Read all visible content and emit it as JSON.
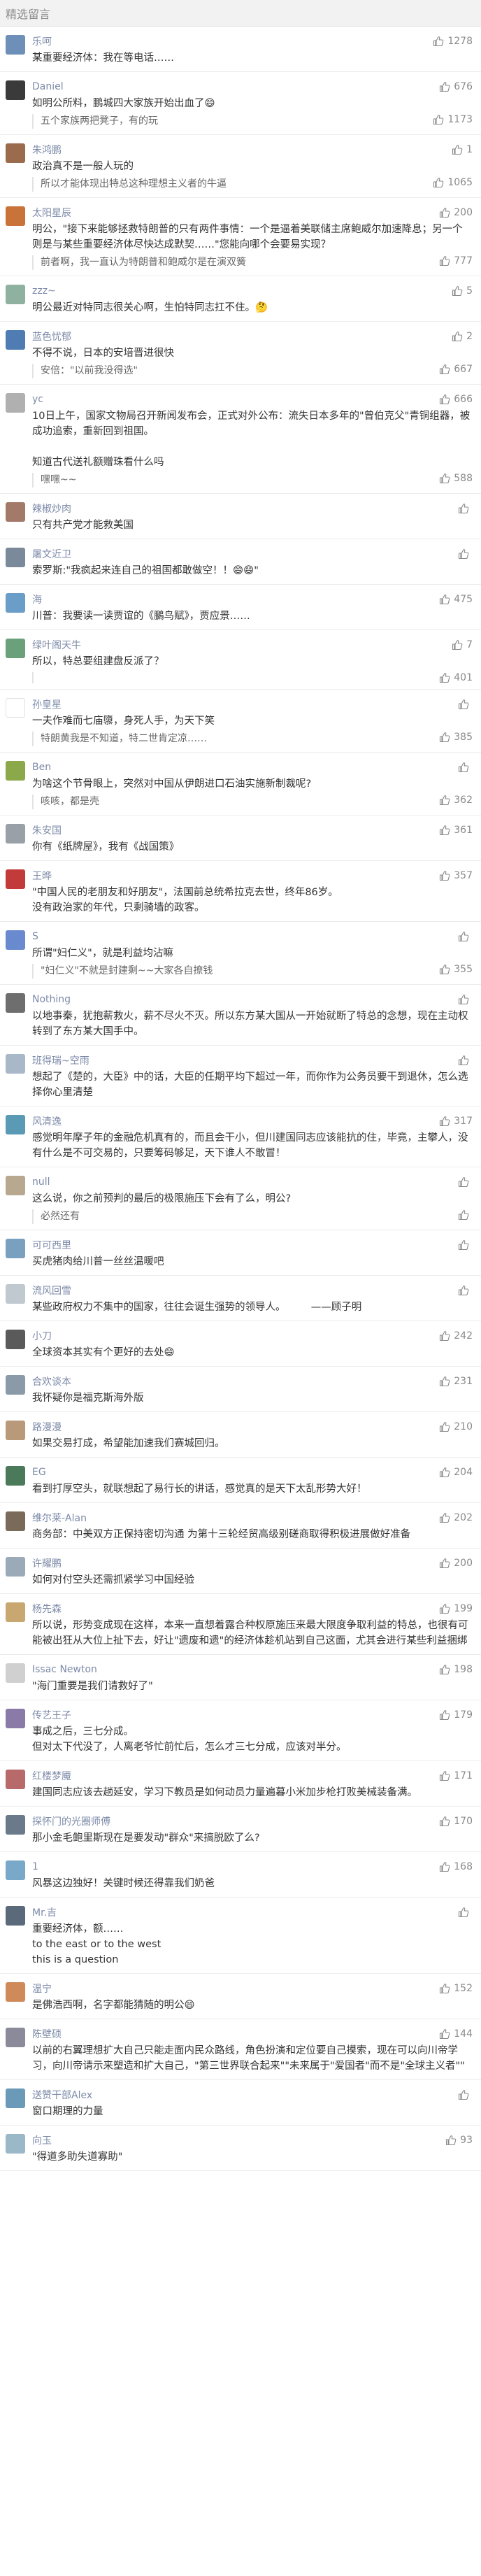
{
  "section": {
    "title": "精选留言"
  },
  "colors": {
    "nickname": "#7c8aa8",
    "text": "#333333",
    "reply_text": "#666666",
    "muted": "#8a8a8a",
    "reply_border": "#e3e3e3"
  },
  "comments": [
    {
      "nickname": "乐呵",
      "avatar_color": "#6d8fb8",
      "likes": "1278",
      "content": "某重要经济体：我在等电话……",
      "reply": null
    },
    {
      "nickname": "Daniel",
      "avatar_color": "#3a3a3a",
      "likes": "676",
      "content": "如明公所料，鹏城四大家族开始出血了😄",
      "reply": {
        "content": "五个家族两把凳子，有的玩",
        "likes": "1173"
      }
    },
    {
      "nickname": "朱鸿鹏",
      "avatar_color": "#9a6b4d",
      "likes": "1",
      "content": "政治真不是一般人玩的",
      "reply": {
        "content": "所以才能体现出特总这种理想主义者的牛逼",
        "likes": "1065"
      }
    },
    {
      "nickname": "太阳星辰",
      "avatar_color": "#c9733a",
      "likes": "200",
      "content": "明公，\"接下来能够拯救特朗普的只有两件事情：一个是逼着美联储主席鲍威尔加速降息；另一个则是与某些重要经济体尽快达成默契……\"您能向哪个会要易实现？",
      "reply": {
        "content": "前者啊，我一直认为特朗普和鲍威尔是在演双簧",
        "likes": "777"
      }
    },
    {
      "nickname": "zzz~",
      "avatar_color": "#8fb2a0",
      "likes": "5",
      "content": "明公最近对特同志很关心啊，生怕特同志扛不住。🤔",
      "reply": null
    },
    {
      "nickname": "蓝色忧郁",
      "avatar_color": "#4f7db3",
      "likes": "2",
      "content": "不得不说，日本的安培晋进很快",
      "reply": {
        "content": "安倍：\"以前我没得选\"",
        "likes": "667"
      }
    },
    {
      "nickname": "yc",
      "avatar_color": "#b0b0b0",
      "likes": "666",
      "content": "10日上午，国家文物局召开新闻发布会，正式对外公布：流失日本多年的\"曾伯克父\"青铜组器，被成功追索，重新回到祖国。\n\n知道古代送礼额赠珠看什么吗",
      "reply": {
        "content": "嘿嘿~~",
        "likes": "588"
      }
    },
    {
      "nickname": "辣椒炒肉",
      "avatar_color": "#a37a6a",
      "likes": "",
      "content": "只有共产党才能救美国",
      "reply": null
    },
    {
      "nickname": "屠文近卫",
      "avatar_color": "#7a8a9a",
      "likes": "",
      "content": "索罗斯:\"我疯起来连自己的祖国都敢做空！！😄😄\"",
      "reply": null
    },
    {
      "nickname": "海",
      "avatar_color": "#6a9ec8",
      "likes": "475",
      "content": "川普：我要读一读贾谊的《鵩鸟赋》，贾应景……",
      "reply": null
    },
    {
      "nickname": "绿叶阁天牛",
      "avatar_color": "#6aa07a",
      "likes": "7",
      "content": "所以，特总要组建盘反派了？",
      "reply": {
        "content": "",
        "likes": "401"
      }
    },
    {
      "nickname": "孙皇星",
      "avatar_color": "#ffffff",
      "likes": "",
      "content": "一夫作难而七庙隳，身死人手，为天下笑",
      "reply": {
        "content": "特朗黄我是不知道，特二世肯定凉……",
        "likes": "385"
      }
    },
    {
      "nickname": "Ben",
      "avatar_color": "#8ba84a",
      "likes": "",
      "content": "为啥这个节骨眼上，突然对中国从伊朗进口石油实施新制裁呢?",
      "reply": {
        "content": "咳咳，都是壳",
        "likes": "362"
      }
    },
    {
      "nickname": "朱安国",
      "avatar_color": "#9aa0a8",
      "likes": "361",
      "content": "你有《纸牌屋》，我有《战国策》",
      "reply": null
    },
    {
      "nickname": "王晔",
      "avatar_color": "#c23a3a",
      "likes": "357",
      "content": "\"中国人民的老朋友和好朋友\"，法国前总统希拉克去世，终年86岁。\n没有政治家的年代，只剩骑墙的政客。",
      "reply": null
    },
    {
      "nickname": "S",
      "avatar_color": "#6a8ad0",
      "likes": "",
      "content": "所谓\"妇仁义\"，就是利益均沾嘛",
      "reply": {
        "content": "\"妇仁义\"不就是封建剩~~大家各自撩钱",
        "likes": "355"
      }
    },
    {
      "nickname": "Nothing",
      "avatar_color": "#6e6e6e",
      "likes": "",
      "content": "以地事秦，犹抱薪救火，薪不尽火不灭。所以东方某大国从一开始就断了特总的念想，现在主动权转到了东方某大国手中。",
      "reply": null
    },
    {
      "nickname": "班得瑞~空雨",
      "avatar_color": "#a8b8c8",
      "likes": "",
      "content": "想起了《楚的，大臣》中的话，大臣的任期平均下超过一年，而你作为公务员要干到退休，怎么选择你心里清楚",
      "reply": null
    },
    {
      "nickname": "风清逸",
      "avatar_color": "#5a9ab5",
      "likes": "317",
      "content": "感觉明年摩子年的金融危机真有的，而且会干小，但川建国同志应该能抗的住，毕竟，主攀人，没有什么是不可交易的，只要筹码够足，天下谁人不敢冒！",
      "reply": null
    },
    {
      "nickname": "null",
      "avatar_color": "#b8a890",
      "likes": "",
      "content": "这么说，你之前预判的最后的极限施压下会有了么，明公?",
      "reply": {
        "content": "必然还有",
        "likes": ""
      }
    },
    {
      "nickname": "可可西里",
      "avatar_color": "#7aa0c0",
      "likes": "",
      "content": "买虎猪肉给川普一丝丝温暖吧",
      "reply": null
    },
    {
      "nickname": "流风回雪",
      "avatar_color": "#c0c8d0",
      "likes": "",
      "content": "某些政府权力不集中的国家，往往会诞生强势的领导人。　　　——顾子明",
      "reply": null
    },
    {
      "nickname": "小刀",
      "avatar_color": "#5a5a5a",
      "likes": "242",
      "content": "全球资本其实有个更好的去处😄",
      "reply": null
    },
    {
      "nickname": "合欢谈本",
      "avatar_color": "#8a9aa8",
      "likes": "231",
      "content": "我怀疑你是福克斯海外版",
      "reply": null
    },
    {
      "nickname": "路漫漫",
      "avatar_color": "#b89a7a",
      "likes": "210",
      "content": "如果交易打成，希望能加速我们赛城回归。",
      "reply": null
    },
    {
      "nickname": "EG",
      "avatar_color": "#4a7a5a",
      "likes": "204",
      "content": "看到打厚空头，就联想起了易行长的讲话，感觉真的是天下太乱形势大好！",
      "reply": null
    },
    {
      "nickname": "维尔莱-Alan",
      "avatar_color": "#7a6a5a",
      "likes": "202",
      "content": "商务部：中美双方正保持密切沟通 为第十三轮经贸高级别磋商取得积极进展做好准备",
      "reply": null
    },
    {
      "nickname": "许耀鹏",
      "avatar_color": "#9aaab8",
      "likes": "200",
      "content": "如何对付空头还需抓紧学习中国经验",
      "reply": null
    },
    {
      "nickname": "杨先森",
      "avatar_color": "#c8a870",
      "likes": "199",
      "content": "所以说，形势变成现在这样，本来一直想着露合种权原施压来最大限度争取利益的特总，也很有可能被出狂从大位上扯下去，好让\"遗废和遗\"的经济体趁机站到自己这面，尤其会进行某些利益捆绑",
      "reply": null
    },
    {
      "nickname": "Issac Newton",
      "avatar_color": "#d0d0d0",
      "likes": "198",
      "content": "\"海门重要是我们请救好了\"",
      "reply": null
    },
    {
      "nickname": "传艺王子",
      "avatar_color": "#8a7aa8",
      "likes": "179",
      "content": "事成之后，三七分成。\n但对太下代没了，人离老爷忙前忙后，怎么才三七分成，应该对半分。",
      "reply": null
    },
    {
      "nickname": "红楼梦魇",
      "avatar_color": "#b86a6a",
      "likes": "171",
      "content": "建国同志应该去趟延安，学习下教员是如何动员力量遍暮小米加步枪打败美械装备满。",
      "reply": null
    },
    {
      "nickname": "探怀门的光圈师傅",
      "avatar_color": "#6a7a8a",
      "likes": "170",
      "content": "那小金毛鲍里斯现在是要发动\"群众\"来搞脱欧了么?",
      "reply": null
    },
    {
      "nickname": "1",
      "avatar_color": "#7aa8c8",
      "likes": "168",
      "content": "风暴这边独好！关键时候还得靠我们奶爸",
      "reply": null
    },
    {
      "nickname": "Mr.吉",
      "avatar_color": "#5a6a7a",
      "likes": "",
      "content": "重要经济体，额……\nto the east or to the west\nthis is a question",
      "reply": null
    },
    {
      "nickname": "温宁",
      "avatar_color": "#d08a5a",
      "likes": "152",
      "content": "是佛浩西啊，名字都能猜随的明公😄",
      "reply": null
    },
    {
      "nickname": "陈壁硕",
      "avatar_color": "#8a8a9a",
      "likes": "144",
      "content": "以前的右翼理想扩大自己只能走面内民众路线，角色扮演和定位要自己摸索，现在可以向川帝学习，向川帝请示来塑造和扩大自己，\"第三世界联合起来\"\"未来属于\"爱国者\"而不是\"全球主义者\"\"",
      "reply": null
    },
    {
      "nickname": "送赞干部Alex",
      "avatar_color": "#6a9ab8",
      "likes": "",
      "content": "窗口期理的力量",
      "reply": null
    },
    {
      "nickname": "向玉",
      "avatar_color": "#9ab8c8",
      "likes": "93",
      "content": "\"得道多助失道寡助\"",
      "reply": null
    }
  ]
}
